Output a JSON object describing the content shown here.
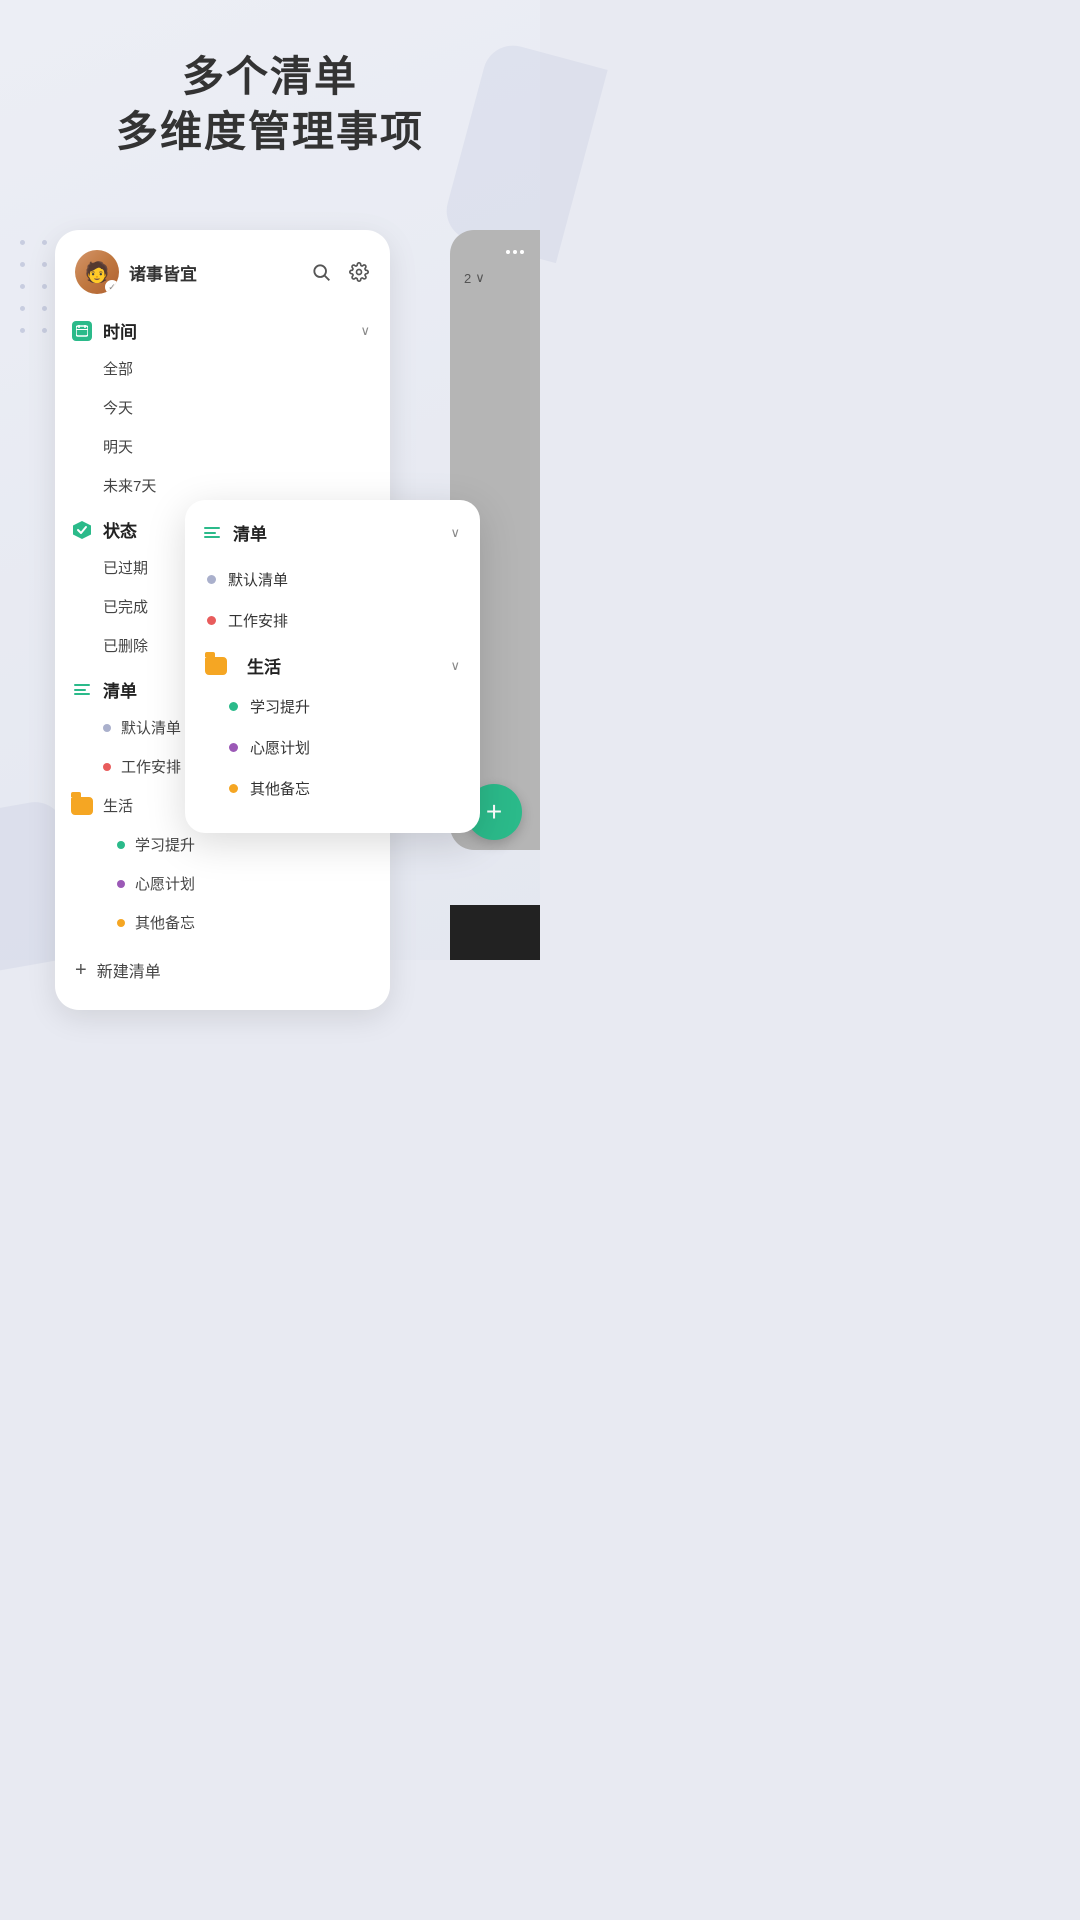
{
  "header": {
    "title_line1": "多个清单",
    "title_line2": "多维度管理事项"
  },
  "sidebar": {
    "username": "诸事皆宜",
    "sections": [
      {
        "id": "time",
        "title": "时间",
        "icon": "time-icon",
        "collapsible": true,
        "items": [
          "全部",
          "今天",
          "明天",
          "未来7天"
        ]
      },
      {
        "id": "status",
        "title": "状态",
        "icon": "status-icon",
        "collapsible": false,
        "items": [
          "已过期",
          "已完成",
          "已删除"
        ]
      },
      {
        "id": "list",
        "title": "清单",
        "icon": "list-icon",
        "collapsible": false,
        "sub_items": [
          {
            "label": "默认清单",
            "color": "#aab0cc"
          },
          {
            "label": "工作安排",
            "color": "#e85c5c"
          }
        ],
        "groups": [
          {
            "label": "生活",
            "color": "#f5a623",
            "icon": "folder",
            "items": [
              {
                "label": "学习提升",
                "color": "#2bba8a"
              },
              {
                "label": "心愿计划",
                "color": "#9b59b6"
              },
              {
                "label": "其他备忘",
                "color": "#f5a623"
              }
            ]
          }
        ]
      }
    ],
    "new_list_label": "新建清单"
  },
  "popup": {
    "section_title": "清单",
    "items": [
      {
        "label": "默认清单",
        "color": "#aab0cc"
      },
      {
        "label": "工作安排",
        "color": "#e85c5c"
      }
    ],
    "group": {
      "label": "生活",
      "color": "#f5a623",
      "items": [
        {
          "label": "学习提升",
          "color": "#2bba8a"
        },
        {
          "label": "心愿计划",
          "color": "#9b59b6"
        },
        {
          "label": "其他备忘",
          "color": "#f5a623"
        }
      ]
    }
  },
  "fab": {
    "label": "+"
  },
  "colors": {
    "accent": "#2bba8a",
    "bg": "#e8eaf2",
    "card_bg": "#ffffff"
  }
}
